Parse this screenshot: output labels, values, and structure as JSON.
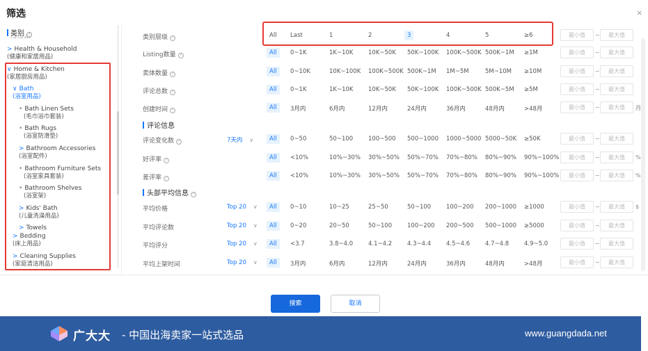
{
  "dialog": {
    "title": "筛选",
    "close": "×"
  },
  "tree": {
    "header": "类别",
    "header_cut": "(子/子品)",
    "items": [
      {
        "arrow": ">",
        "en": "Health & Household",
        "cn": "(健康和家居用品)"
      },
      {
        "arrow": "∨",
        "en": "Home & Kitchen",
        "cn": "(家居厨房用品)"
      },
      {
        "arrow": "∨",
        "en": "Bath",
        "cn": "(浴室用品)"
      },
      {
        "arrow": "•",
        "en": "Bath Linen Sets",
        "cn": "(毛巾浴巾套装)"
      },
      {
        "arrow": "•",
        "en": "Bath Rugs",
        "cn": "(浴室防滑垫)"
      },
      {
        "arrow": ">",
        "en": "Bathroom Accessories",
        "cn": "(浴室配件)"
      },
      {
        "arrow": "•",
        "en": "Bathroom Furniture Sets",
        "cn": "(浴室家具套装)"
      },
      {
        "arrow": "•",
        "en": "Bathroom Shelves",
        "cn": "(浴室架)"
      },
      {
        "arrow": ">",
        "en": "Kids' Bath",
        "cn": "(儿童洗澡用品)"
      },
      {
        "arrow": ">",
        "en": "Towels",
        "cn": ""
      },
      {
        "arrow": ">",
        "en": "Bedding",
        "cn": "(床上用品)"
      },
      {
        "arrow": ">",
        "en": "Cleaning Supplies",
        "cn": "(家庭清洁用品)"
      }
    ]
  },
  "filters": {
    "rows": [
      {
        "label": "类别层级",
        "options": [
          "All",
          "Last",
          "1",
          "2",
          "3",
          "4",
          "5",
          "≥6"
        ],
        "min": "最小值",
        "max": "最大值",
        "unit": ""
      },
      {
        "label": "Listing数量",
        "options": [
          "All",
          "0~1K",
          "1K~10K",
          "10K~50K",
          "50K~100K",
          "100K~500K",
          "500K~1M",
          "≥1M"
        ],
        "min": "最小值",
        "max": "最大值",
        "unit": ""
      },
      {
        "label": "卖体数量",
        "options": [
          "All",
          "0~10K",
          "10K~100K",
          "100K~500K",
          "500K~1M",
          "1M~5M",
          "5M~10M",
          "≥10M"
        ],
        "min": "最小值",
        "max": "最大值",
        "unit": ""
      },
      {
        "label": "评论总数",
        "options": [
          "All",
          "0~1K",
          "1K~10K",
          "10K~50K",
          "50K~100K",
          "100K~500K",
          "500K~5M",
          "≥5M"
        ],
        "min": "最小值",
        "max": "最大值",
        "unit": ""
      },
      {
        "label": "创建时间",
        "options": [
          "All",
          "3月内",
          "6月内",
          "12月内",
          "24月内",
          "36月内",
          "48月内",
          ">48月"
        ],
        "min": "最小值",
        "max": "最大值",
        "unit": "月"
      },
      {
        "label": "评论变化数",
        "select": "7天内",
        "options": [
          "All",
          "0~50",
          "50~100",
          "100~500",
          "500~1000",
          "1000~5000",
          "5000~50K",
          "≥50K"
        ],
        "min": "最小值",
        "max": "最大值",
        "unit": ""
      },
      {
        "label": "好评率",
        "options": [
          "All",
          "<10%",
          "10%~30%",
          "30%~50%",
          "50%~70%",
          "70%~80%",
          "80%~90%",
          "90%~100%"
        ],
        "min": "最小值",
        "max": "最大值",
        "unit": "%"
      },
      {
        "label": "差评率",
        "options": [
          "All",
          "<10%",
          "10%~30%",
          "30%~50%",
          "50%~70%",
          "70%~80%",
          "80%~90%",
          "90%~100%"
        ],
        "min": "最小值",
        "max": "最大值",
        "unit": "%"
      },
      {
        "label": "平均价格",
        "select": "Top 20",
        "options": [
          "All",
          "0~10",
          "10~25",
          "25~50",
          "50~100",
          "100~200",
          "200~1000",
          "≥1000"
        ],
        "min": "最小值",
        "max": "最大值",
        "unit": "$"
      },
      {
        "label": "平均评论数",
        "select": "Top 20",
        "options": [
          "All",
          "0~20",
          "20~50",
          "50~100",
          "100~200",
          "200~500",
          "500~1000",
          "≥5000"
        ],
        "min": "最小值",
        "max": "最大值",
        "unit": ""
      },
      {
        "label": "平均评分",
        "select": "Top 20",
        "options": [
          "All",
          "<3.7",
          "3.8~4.0",
          "4.1~4.2",
          "4.3~4.4",
          "4.5~4.6",
          "4.7~4.8",
          "4.9~5.0"
        ],
        "min": "最小值",
        "max": "最大值",
        "unit": ""
      },
      {
        "label": "平均上架时间",
        "select": "Top 20",
        "options": [
          "All",
          "3月内",
          "6月内",
          "12月内",
          "24月内",
          "36月内",
          "48月内",
          ">48月"
        ],
        "min": "最小值",
        "max": "最大值",
        "unit": ""
      }
    ],
    "sections": [
      "评论信息",
      "头部平均信息"
    ]
  },
  "buttons": {
    "search": "搜索",
    "cancel": "取消"
  },
  "footer": {
    "brand": "广大大",
    "slogan": "- 中国出海卖家一站式选品",
    "url": "www.guangdada.net"
  },
  "colors": {
    "accent": "#1677ff",
    "highlight": "#e53935",
    "footer_bg": "#2e5ca0"
  }
}
